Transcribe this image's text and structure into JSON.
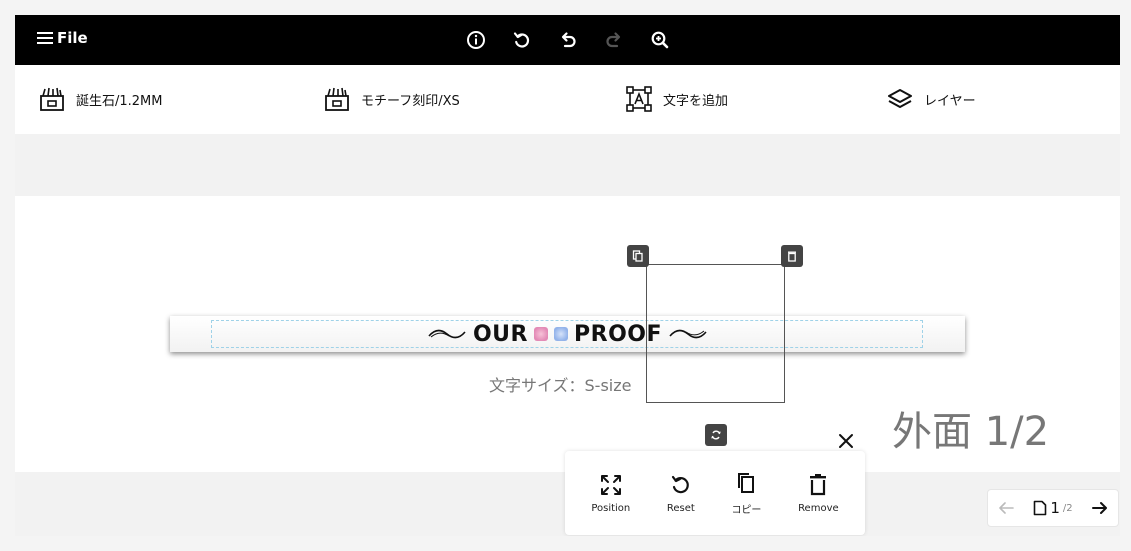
{
  "topbar": {
    "file_label": "File"
  },
  "tools": {
    "birthstone_label": "誕生石/1.2MM",
    "motif_label": "モチーフ刻印/XS",
    "add_text_label": "文字を追加",
    "layer_label": "レイヤー"
  },
  "canvas": {
    "engraving_left": "OUR",
    "engraving_right": "PROOF",
    "size_label": "文字サイズ：S-size",
    "face_label": "外面 1/2"
  },
  "context_menu": {
    "position_label": "Position",
    "reset_label": "Reset",
    "copy_label": "コピー",
    "remove_label": "Remove"
  },
  "pager": {
    "current": "1",
    "total": "/2"
  },
  "colors": {
    "topbar_bg": "#000000",
    "gem_pink": "#e38ab6",
    "gem_blue": "#93b3ea",
    "dash_guide": "#9fd2e8"
  }
}
